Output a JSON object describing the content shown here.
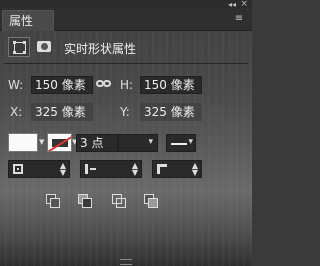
{
  "panel": {
    "tab_label": "属性",
    "collapse_glyph": "◂◂",
    "close_glyph": "×",
    "menu_glyph": "≡",
    "title": "实时形状属性"
  },
  "size": {
    "w_label": "W:",
    "w_value": "150 像素",
    "h_label": "H:",
    "h_value": "150 像素"
  },
  "position": {
    "x_label": "X:",
    "x_value": "325 像素",
    "y_label": "Y:",
    "y_value": "325 像素"
  },
  "stroke": {
    "fill_color": "#fafafa",
    "width_value": "3 点",
    "dropdown_glyph": "▾"
  },
  "path_operations": [
    "combine",
    "subtract",
    "intersect",
    "exclude"
  ],
  "icons": {
    "shape": "shape-bounds-icon",
    "mask": "mask-icon",
    "link": "link-icon"
  }
}
